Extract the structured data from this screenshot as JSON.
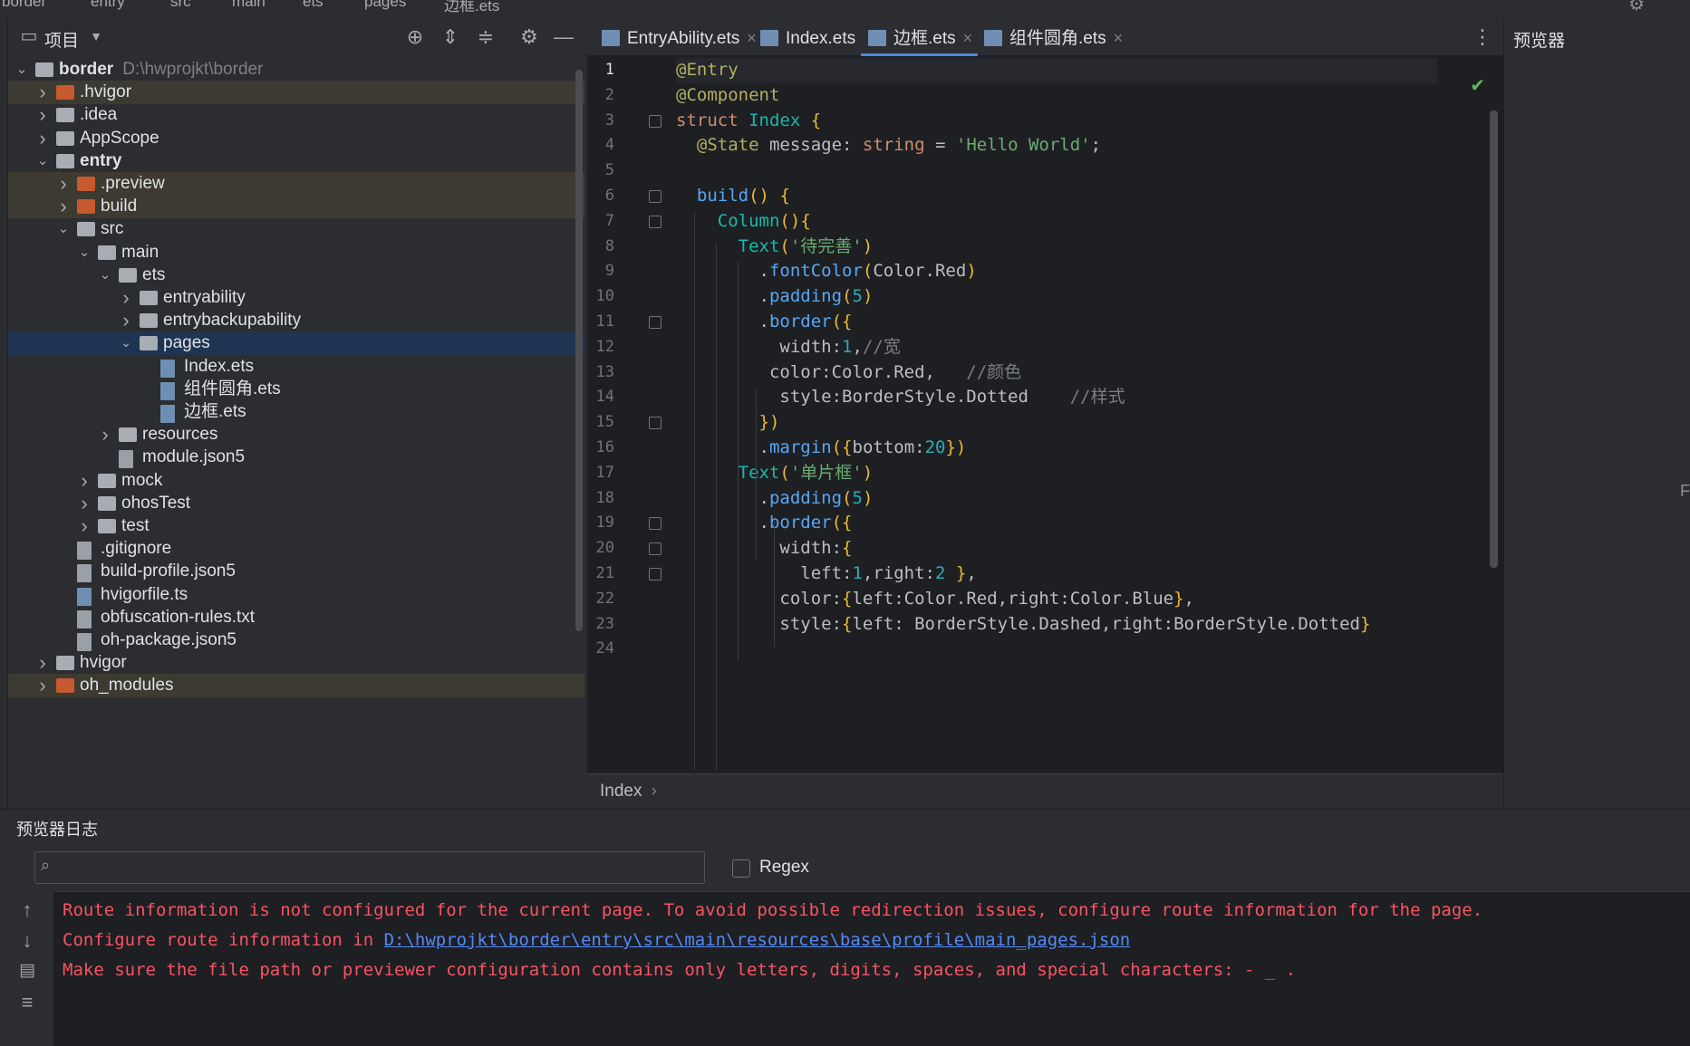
{
  "breadcrumb": [
    "border",
    "entry",
    "src",
    "main",
    "ets",
    "pages",
    "边框.ets"
  ],
  "project_panel": {
    "title": "项目",
    "tree": [
      {
        "label": "border",
        "path": "D:\\hwprojkt\\border",
        "depth": 0,
        "expanded": true,
        "kind": "folder-blue",
        "bold": true
      },
      {
        "label": ".hvigor",
        "depth": 1,
        "expanded": false,
        "kind": "folder-orange",
        "highlight": "ignored"
      },
      {
        "label": ".idea",
        "depth": 1,
        "expanded": false,
        "kind": "folder"
      },
      {
        "label": "AppScope",
        "depth": 1,
        "expanded": false,
        "kind": "folder"
      },
      {
        "label": "entry",
        "depth": 1,
        "expanded": true,
        "kind": "folder-blue",
        "bold": true
      },
      {
        "label": ".preview",
        "depth": 2,
        "expanded": false,
        "kind": "folder-orange",
        "highlight": "ignored"
      },
      {
        "label": "build",
        "depth": 2,
        "expanded": false,
        "kind": "folder-orange",
        "highlight": "ignored"
      },
      {
        "label": "src",
        "depth": 2,
        "expanded": true,
        "kind": "folder"
      },
      {
        "label": "main",
        "depth": 3,
        "expanded": true,
        "kind": "folder"
      },
      {
        "label": "ets",
        "depth": 4,
        "expanded": true,
        "kind": "folder-blue"
      },
      {
        "label": "entryability",
        "depth": 5,
        "expanded": false,
        "kind": "folder"
      },
      {
        "label": "entrybackupability",
        "depth": 5,
        "expanded": false,
        "kind": "folder"
      },
      {
        "label": "pages",
        "depth": 5,
        "expanded": true,
        "kind": "folder",
        "highlight": "selected"
      },
      {
        "label": "Index.ets",
        "depth": 6,
        "kind": "file"
      },
      {
        "label": "组件圆角.ets",
        "depth": 6,
        "kind": "file"
      },
      {
        "label": "边框.ets",
        "depth": 6,
        "kind": "file"
      },
      {
        "label": "resources",
        "depth": 4,
        "expanded": false,
        "kind": "folder"
      },
      {
        "label": "module.json5",
        "depth": 4,
        "kind": "config"
      },
      {
        "label": "mock",
        "depth": 3,
        "expanded": false,
        "kind": "folder"
      },
      {
        "label": "ohosTest",
        "depth": 3,
        "expanded": false,
        "kind": "folder"
      },
      {
        "label": "test",
        "depth": 3,
        "expanded": false,
        "kind": "folder"
      },
      {
        "label": ".gitignore",
        "depth": 2,
        "kind": "config"
      },
      {
        "label": "build-profile.json5",
        "depth": 2,
        "kind": "config"
      },
      {
        "label": "hvigorfile.ts",
        "depth": 2,
        "kind": "file"
      },
      {
        "label": "obfuscation-rules.txt",
        "depth": 2,
        "kind": "config"
      },
      {
        "label": "oh-package.json5",
        "depth": 2,
        "kind": "config"
      },
      {
        "label": "hvigor",
        "depth": 1,
        "expanded": false,
        "kind": "folder"
      },
      {
        "label": "oh_modules",
        "depth": 1,
        "expanded": false,
        "kind": "folder-orange",
        "highlight": "ignored"
      }
    ]
  },
  "editor": {
    "tabs": [
      {
        "label": "EntryAbility.ets",
        "active": false
      },
      {
        "label": "Index.ets",
        "active": false
      },
      {
        "label": "边框.ets",
        "active": true
      },
      {
        "label": "组件圆角.ets",
        "active": false
      }
    ],
    "line_numbers": [
      "1",
      "2",
      "3",
      "4",
      "5",
      "6",
      "7",
      "8",
      "9",
      "10",
      "11",
      "12",
      "13",
      "14",
      "15",
      "16",
      "17",
      "18",
      "19",
      "20",
      "21",
      "22",
      "23",
      "24"
    ],
    "code_lines": [
      "@Entry",
      "@Component",
      "struct Index {",
      "  @State message: string = 'Hello World';",
      "",
      "  build() {",
      "    Column(){",
      "      Text('待完善')",
      "        .fontColor(Color.Red)",
      "        .padding(5)",
      "        .border({",
      "          width:1,//宽",
      "         color:Color.Red,   //颜色",
      "          style:BorderStyle.Dotted    //样式",
      "        })",
      "        .margin({bottom:20})",
      "      Text('单片框')",
      "        .padding(5)",
      "        .border({",
      "          width:{",
      "            left:1,right:2 },",
      "          color:{left:Color.Red,right:Color.Blue},",
      "          style:{left: BorderStyle.Dashed,right:BorderStyle.Dotted}",
      ""
    ],
    "breadcrumb": "Index"
  },
  "previewer": {
    "title": "预览器",
    "edge_letter": "F"
  },
  "log_panel": {
    "title": "预览器日志",
    "search_value": "",
    "regex_label": "Regex",
    "regex_checked": false,
    "lines": [
      {
        "text": "Route information is not configured for the current page. To avoid possible redirection issues, configure route information for the page."
      },
      {
        "prefix": "Configure route information in ",
        "link": "D:\\hwprojkt\\border\\entry\\src\\main\\resources\\base\\profile\\main_pages.json"
      },
      {
        "text": "Make sure the file path or previewer configuration contains only letters, digits, spaces, and special characters: - _ ."
      }
    ]
  },
  "colors": {
    "background": "#2b2d30",
    "editor_bg": "#1e1f22",
    "selection": "#1f3452",
    "error_text": "#f75464",
    "link": "#548af7",
    "accent": "#4a8ae0"
  }
}
